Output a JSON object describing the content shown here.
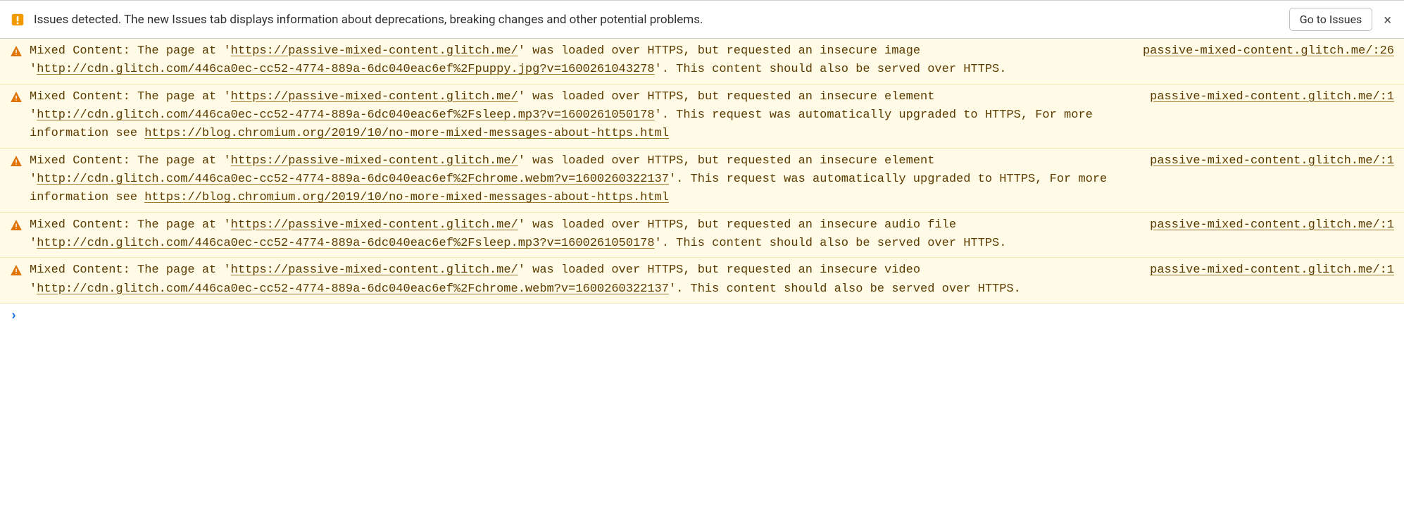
{
  "topbar": {
    "issues_text": "Issues detected. The new Issues tab displays information about deprecations, breaking changes and other potential problems.",
    "go_to_issues": "Go to Issues",
    "close": "×"
  },
  "warnings": [
    {
      "source_label": "passive-mixed-content.glitch.me/:26",
      "segments": [
        {
          "t": "Mixed Content: The page at '"
        },
        {
          "t": "https://passive-mixed-content.glitch.me/",
          "u": true
        },
        {
          "t": "' was loaded over HTTPS, but requested an insecure image '"
        },
        {
          "t": "http://cdn.glitch.com/446ca0ec-cc52-4774-889a-6dc040eac6ef%2Fpuppy.jpg?v=1600261043278",
          "u": true
        },
        {
          "t": "'. This content should also be served over HTTPS."
        }
      ]
    },
    {
      "source_label": "passive-mixed-content.glitch.me/:1",
      "segments": [
        {
          "t": "Mixed Content: The page at '"
        },
        {
          "t": "https://passive-mixed-content.glitch.me/",
          "u": true
        },
        {
          "t": "' was loaded over HTTPS, but requested an insecure element '"
        },
        {
          "t": "http://cdn.glitch.com/446ca0ec-cc52-4774-889a-6dc040eac6ef%2Fsleep.mp3?v=1600261050178",
          "u": true
        },
        {
          "t": "'. This request was automatically upgraded to HTTPS, For more information see "
        },
        {
          "t": "https://blog.chromium.org/2019/10/no-more-mixed-messages-about-https.html",
          "u": true
        }
      ]
    },
    {
      "source_label": "passive-mixed-content.glitch.me/:1",
      "segments": [
        {
          "t": "Mixed Content: The page at '"
        },
        {
          "t": "https://passive-mixed-content.glitch.me/",
          "u": true
        },
        {
          "t": "' was loaded over HTTPS, but requested an insecure element '"
        },
        {
          "t": "http://cdn.glitch.com/446ca0ec-cc52-4774-889a-6dc040eac6ef%2Fchrome.webm?v=1600260322137",
          "u": true
        },
        {
          "t": "'. This request was automatically upgraded to HTTPS, For more information see "
        },
        {
          "t": "https://blog.chromium.org/2019/10/no-more-mixed-messages-about-https.html",
          "u": true
        }
      ]
    },
    {
      "source_label": "passive-mixed-content.glitch.me/:1",
      "segments": [
        {
          "t": "Mixed Content: The page at '"
        },
        {
          "t": "https://passive-mixed-content.glitch.me/",
          "u": true
        },
        {
          "t": "' was loaded over HTTPS, but requested an insecure audio file '"
        },
        {
          "t": "http://cdn.glitch.com/446ca0ec-cc52-4774-889a-6dc040eac6ef%2Fsleep.mp3?v=1600261050178",
          "u": true
        },
        {
          "t": "'. This content should also be served over HTTPS."
        }
      ]
    },
    {
      "source_label": "passive-mixed-content.glitch.me/:1",
      "segments": [
        {
          "t": "Mixed Content: The page at '"
        },
        {
          "t": "https://passive-mixed-content.glitch.me/",
          "u": true
        },
        {
          "t": "' was loaded over HTTPS, but requested an insecure video '"
        },
        {
          "t": "http://cdn.glitch.com/446ca0ec-cc52-4774-889a-6dc040eac6ef%2Fchrome.webm?v=1600260322137",
          "u": true
        },
        {
          "t": "'. This content should also be served over HTTPS."
        }
      ]
    }
  ],
  "prompt_symbol": "›"
}
